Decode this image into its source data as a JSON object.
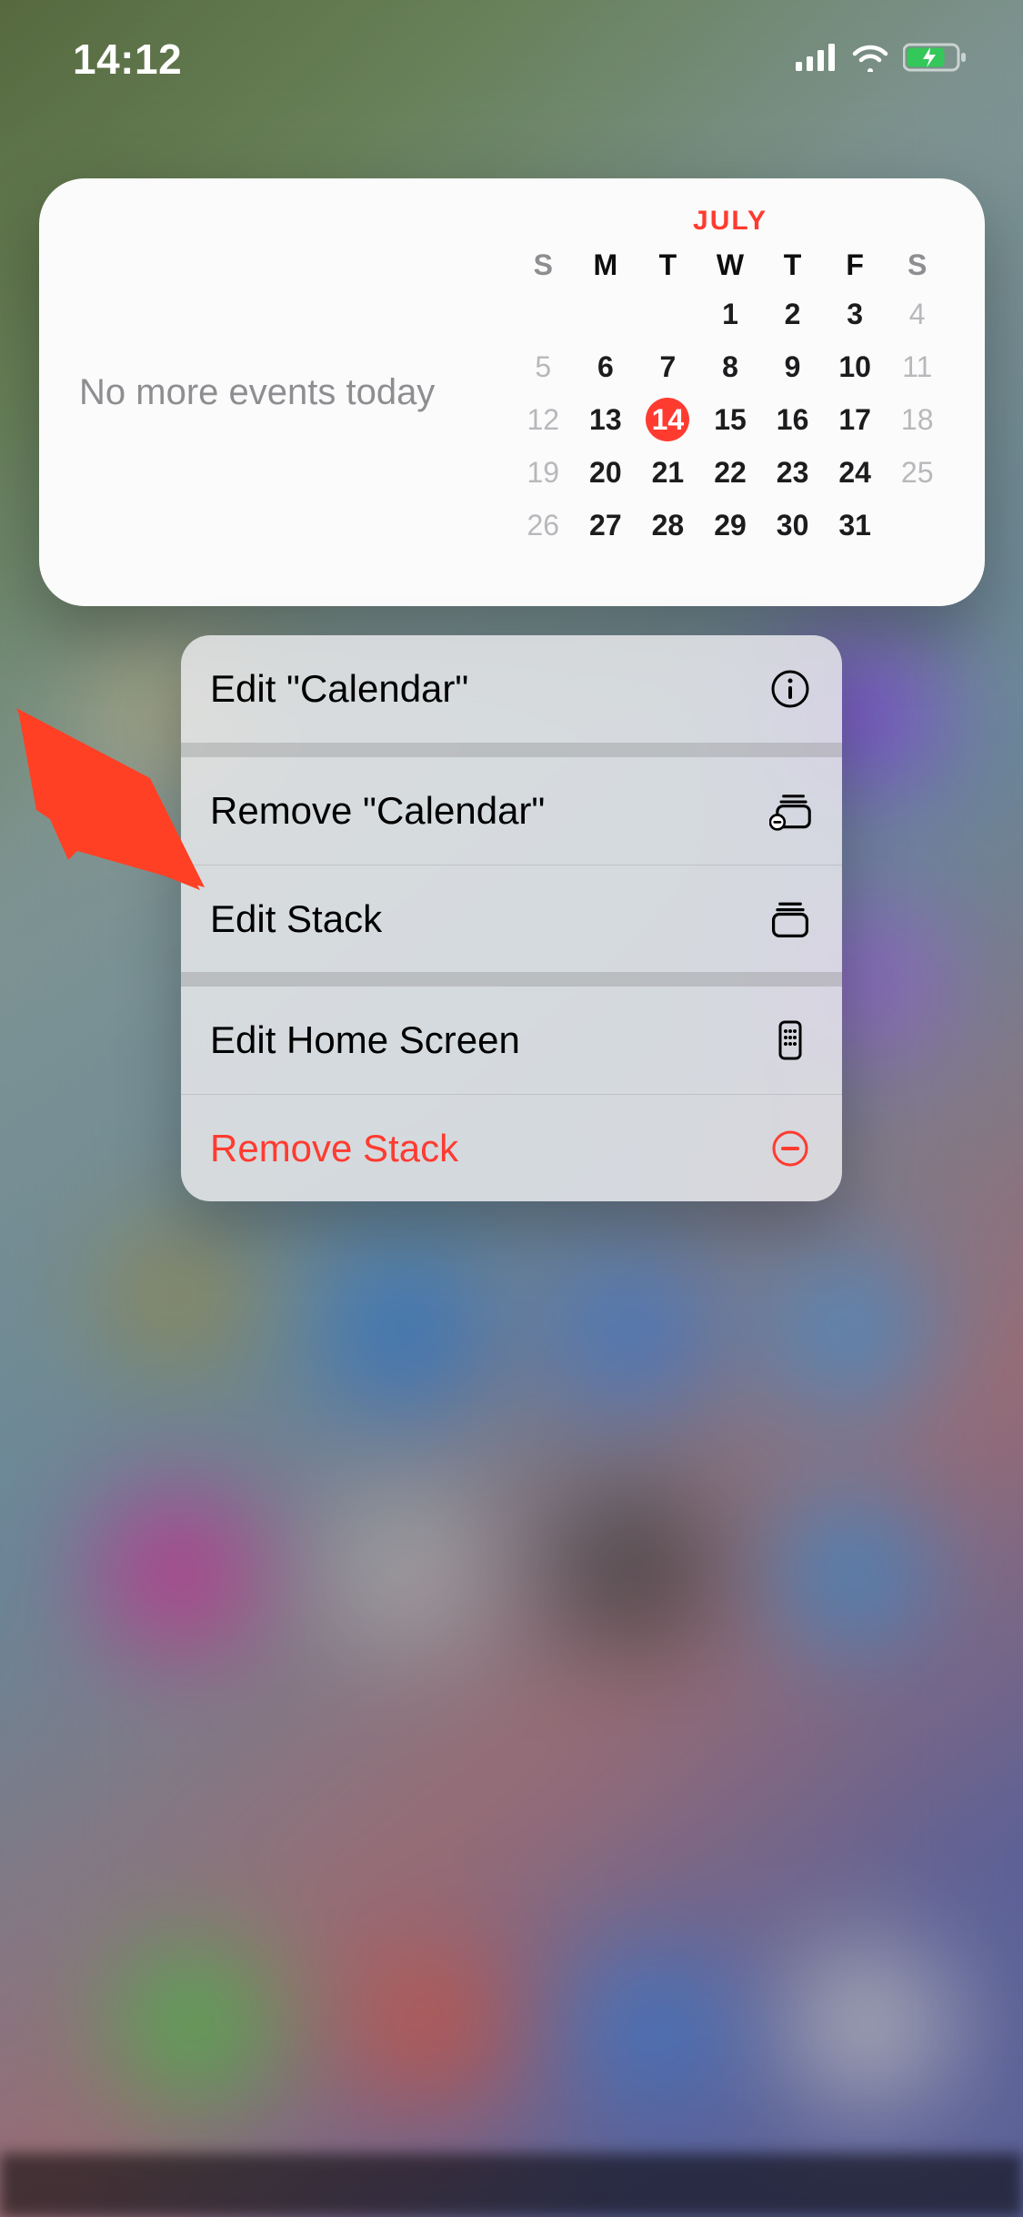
{
  "status": {
    "time": "14:12"
  },
  "widget": {
    "message": "No more events today",
    "month_label": "JULY",
    "day_headers": [
      "S",
      "M",
      "T",
      "W",
      "T",
      "F",
      "S"
    ],
    "weeks": [
      [
        {
          "d": "",
          "o": false
        },
        {
          "d": "",
          "o": false
        },
        {
          "d": "",
          "o": false
        },
        {
          "d": "1",
          "o": false
        },
        {
          "d": "2",
          "o": false
        },
        {
          "d": "3",
          "o": false
        },
        {
          "d": "4",
          "o": true
        }
      ],
      [
        {
          "d": "5",
          "o": true
        },
        {
          "d": "6",
          "o": false
        },
        {
          "d": "7",
          "o": false
        },
        {
          "d": "8",
          "o": false
        },
        {
          "d": "9",
          "o": false
        },
        {
          "d": "10",
          "o": false
        },
        {
          "d": "11",
          "o": true
        }
      ],
      [
        {
          "d": "12",
          "o": true
        },
        {
          "d": "13",
          "o": false
        },
        {
          "d": "14",
          "o": false,
          "today": true
        },
        {
          "d": "15",
          "o": false
        },
        {
          "d": "16",
          "o": false
        },
        {
          "d": "17",
          "o": false
        },
        {
          "d": "18",
          "o": true
        }
      ],
      [
        {
          "d": "19",
          "o": true
        },
        {
          "d": "20",
          "o": false
        },
        {
          "d": "21",
          "o": false
        },
        {
          "d": "22",
          "o": false
        },
        {
          "d": "23",
          "o": false
        },
        {
          "d": "24",
          "o": false
        },
        {
          "d": "25",
          "o": true
        }
      ],
      [
        {
          "d": "26",
          "o": true
        },
        {
          "d": "27",
          "o": false
        },
        {
          "d": "28",
          "o": false
        },
        {
          "d": "29",
          "o": false
        },
        {
          "d": "30",
          "o": false
        },
        {
          "d": "31",
          "o": false
        },
        {
          "d": "",
          "o": false
        }
      ]
    ]
  },
  "menu": {
    "items": [
      {
        "label": "Edit \"Calendar\"",
        "icon": "info-circle-icon",
        "destructive": false
      },
      {
        "label": "Remove \"Calendar\"",
        "icon": "remove-stack-item-icon",
        "destructive": false
      },
      {
        "label": "Edit Stack",
        "icon": "stack-icon",
        "destructive": false
      },
      {
        "label": "Edit Home Screen",
        "icon": "phone-apps-icon",
        "destructive": false
      },
      {
        "label": "Remove Stack",
        "icon": "minus-circle-icon",
        "destructive": true
      }
    ]
  },
  "colors": {
    "accent_red": "#ff3b30",
    "menu_bg": "rgba(235,235,238,0.82)",
    "text_secondary": "#8e8e92"
  }
}
